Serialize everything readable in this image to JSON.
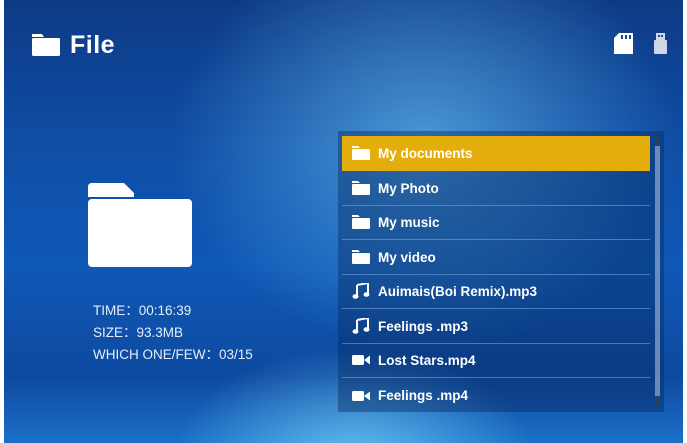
{
  "header": {
    "title": "File",
    "folder_icon": "folder-icon",
    "storage_icons": [
      "sd-card-icon",
      "usb-drive-icon"
    ]
  },
  "info": {
    "time": "TIME：00:16:39",
    "size": "SIZE：93.3MB",
    "which": "WHICH ONE/FEW：03/15"
  },
  "file_list": {
    "items": [
      {
        "label": "My documents",
        "icon": "folder-icon",
        "selected": true
      },
      {
        "label": "My Photo",
        "icon": "folder-icon",
        "selected": false
      },
      {
        "label": "My music",
        "icon": "folder-icon",
        "selected": false
      },
      {
        "label": "My video",
        "icon": "folder-icon",
        "selected": false
      },
      {
        "label": "Auimais(Boi Remix).mp3",
        "icon": "music-note-icon",
        "selected": false
      },
      {
        "label": "Feelings .mp3",
        "icon": "music-note-icon",
        "selected": false
      },
      {
        "label": "Lost Stars.mp4",
        "icon": "video-camera-icon",
        "selected": false
      },
      {
        "label": "Feelings .mp4",
        "icon": "video-camera-icon",
        "selected": false
      }
    ]
  },
  "colors": {
    "selection": "#e3ad0c",
    "background": "#0f4fa7",
    "text": "#ffffff"
  }
}
